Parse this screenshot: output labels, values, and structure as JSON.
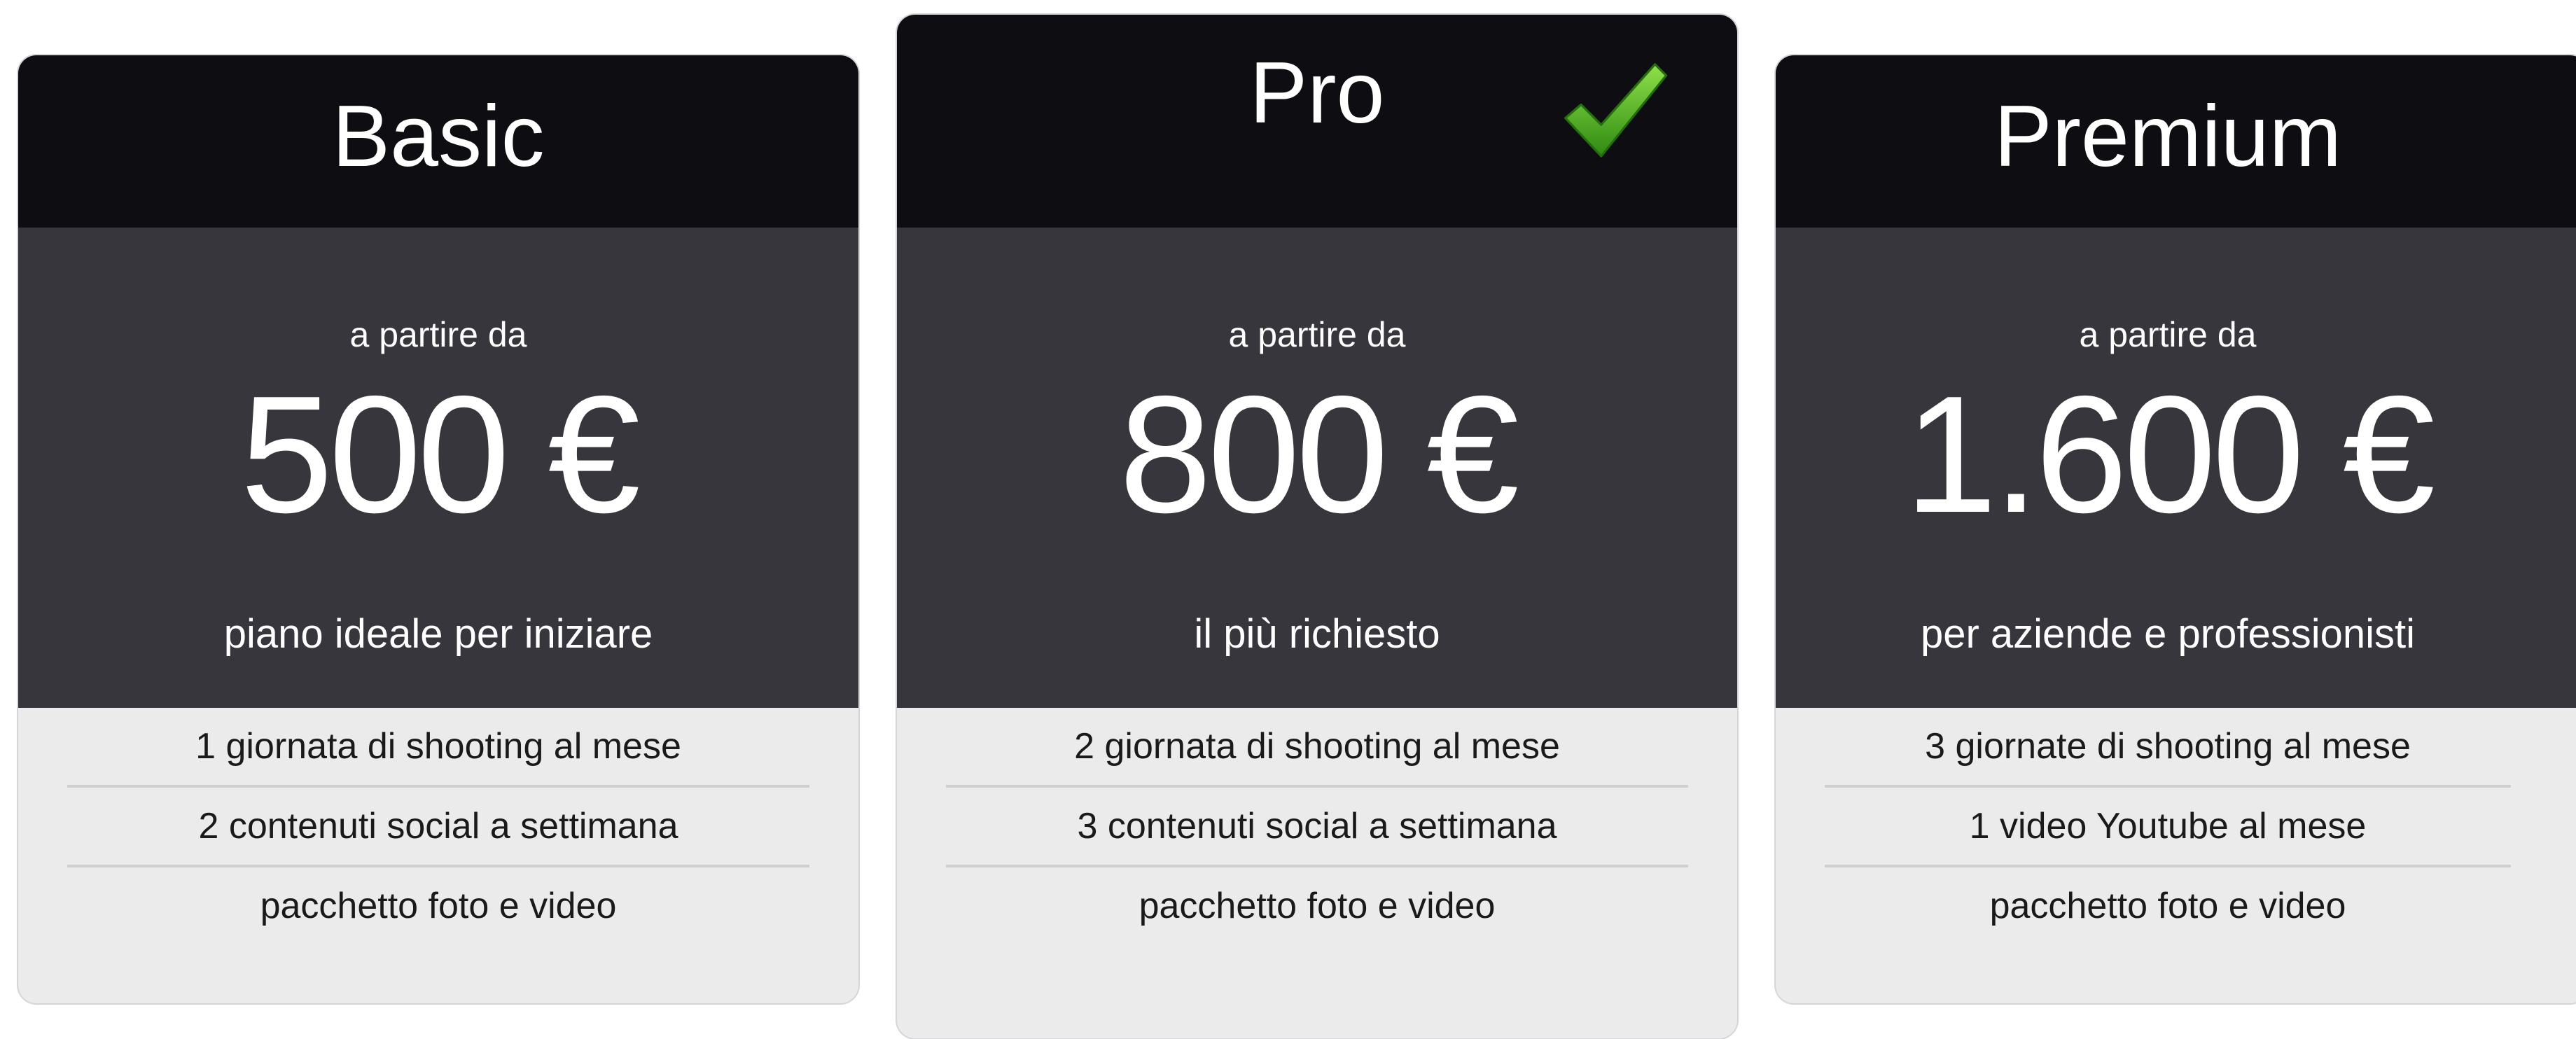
{
  "plans": [
    {
      "name": "Basic",
      "starting_label": "a partire da",
      "price": "500 €",
      "tagline": "piano ideale per iniziare",
      "features": [
        "1 giornata di shooting al mese",
        "2 contenuti social a settimana",
        "pacchetto foto e video"
      ]
    },
    {
      "name": "Pro",
      "starting_label": "a partire da",
      "price": "800 €",
      "tagline": "il più richiesto",
      "badge_icon": "check-icon",
      "features": [
        "2 giornata di shooting al mese",
        "3 contenuti social a settimana",
        "pacchetto foto e video"
      ]
    },
    {
      "name": "Premium",
      "starting_label": "a partire da",
      "price": "1.600 €",
      "tagline": "per aziende e professionisti",
      "features": [
        "3 giornate di shooting al mese",
        "1 video Youtube al mese",
        "pacchetto foto e video"
      ]
    }
  ],
  "colors": {
    "header_bg": "#0e0e12",
    "body_bg": "#37363c",
    "features_bg": "#ebebeb",
    "check_green": "#4caf1f"
  }
}
